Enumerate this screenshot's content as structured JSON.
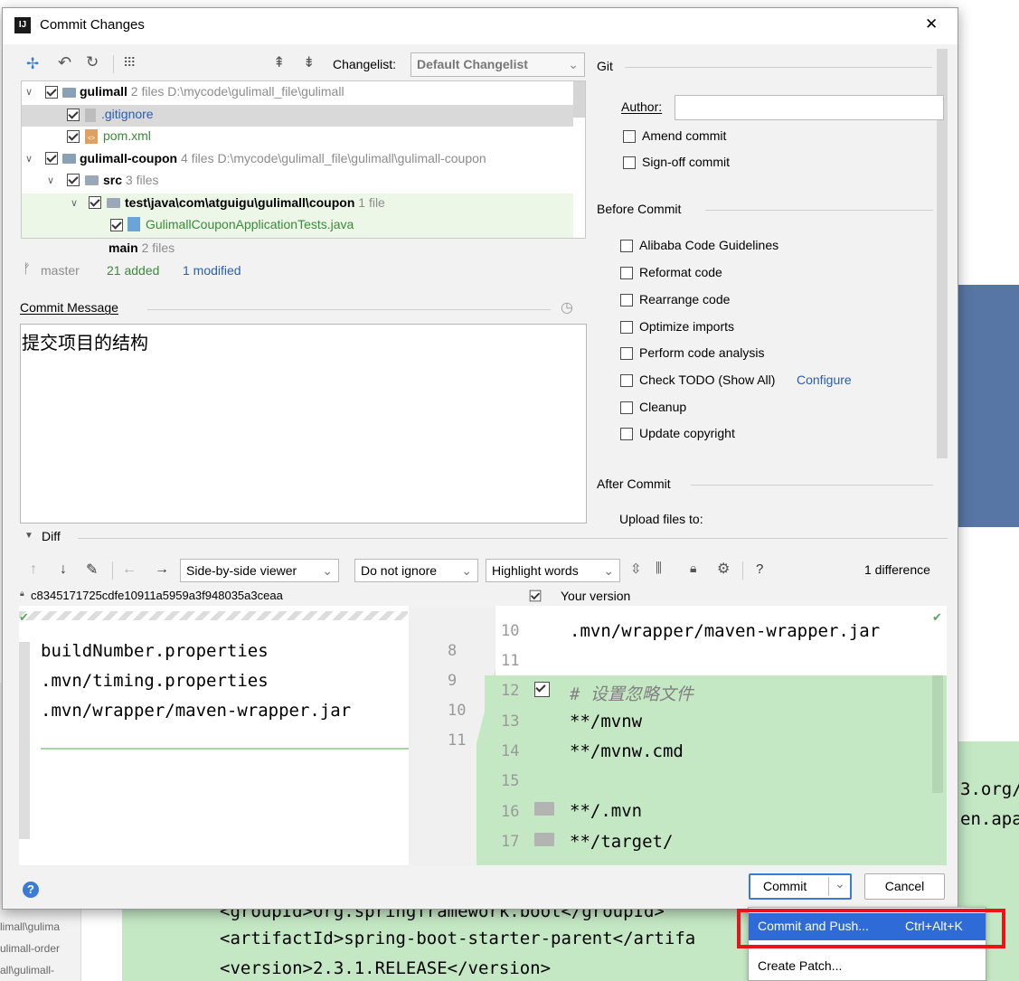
{
  "dialog": {
    "title": "Commit Changes",
    "close_glyph": "✕",
    "app_icon_text": "IJ"
  },
  "toolbar": {
    "changelist_label": "Changelist:",
    "changelist_value": "Default Changelist"
  },
  "tree": {
    "root1": {
      "name": "gulimall",
      "meta": "2 files  D:\\mycode\\gulimall_file\\gulimall"
    },
    "file1": ".gitignore",
    "file2": "pom.xml",
    "root2": {
      "name": "gulimall-coupon",
      "meta": "4 files  D:\\mycode\\gulimall_file\\gulimall\\gulimall-coupon"
    },
    "src": {
      "name": "src",
      "meta": "3 files"
    },
    "test": {
      "name": "test\\java\\com\\atguigu\\gulimall\\coupon",
      "meta": "1 file"
    },
    "file3": "GulimallCouponApplicationTests.java",
    "main": {
      "name": "main",
      "meta": "2 files"
    }
  },
  "status": {
    "branch": "master",
    "added": "21 added",
    "modified": "1 modified"
  },
  "commit_message": {
    "label": "Commit Message",
    "text": "提交项目的结构"
  },
  "git": {
    "section": "Git",
    "author_label": "Author:",
    "author_value": "",
    "amend": "Amend commit",
    "signoff": "Sign-off commit",
    "before_commit": "Before Commit",
    "options": [
      "Alibaba Code Guidelines",
      "Reformat code",
      "Rearrange code",
      "Optimize imports",
      "Perform code analysis",
      "Check TODO (Show All)",
      "Cleanup",
      "Update copyright"
    ],
    "configure": "Configure",
    "after_commit": "After Commit",
    "upload": "Upload files to:"
  },
  "diff": {
    "section": "Diff",
    "viewer": "Side-by-side viewer",
    "ignore": "Do not ignore",
    "highlight": "Highlight words",
    "differences": "1 difference",
    "help": "?",
    "left_rev": "c8345171725cdfe10911a5959a3f948035a3ceaa",
    "right_rev": "Your version",
    "left_lines": [
      "buildNumber.properties",
      ".mvn/timing.properties",
      ".mvn/wrapper/maven-wrapper.jar"
    ],
    "left_nums": [
      "8",
      "9",
      "10",
      "11"
    ],
    "right_nums": [
      "10",
      "11",
      "12",
      "13",
      "14",
      "15",
      "16",
      "17"
    ],
    "right_lines": [
      ".mvn/wrapper/maven-wrapper.jar",
      "",
      "# 设置忽略文件",
      "**/mvnw",
      "**/mvnw.cmd",
      "",
      "**/.mvn",
      "**/target/"
    ]
  },
  "buttons": {
    "commit": "Commit",
    "cancel": "Cancel"
  },
  "popup": {
    "commit_push": "Commit and Push...",
    "shortcut": "Ctrl+Alt+K",
    "create_patch": "Create Patch..."
  },
  "background": {
    "groupId": "<groupId>org.springframework.boot</groupId>",
    "artifactId": "<artifactId>spring-boot-starter-parent</artifa",
    "version": "<version>2.3.1.RELEASE</version>",
    "right1": "3.org/",
    "right2": "en.apa",
    "side1": "limall\\gulima",
    "side2": "ulimall-order",
    "side3": "all\\gulimall-"
  }
}
